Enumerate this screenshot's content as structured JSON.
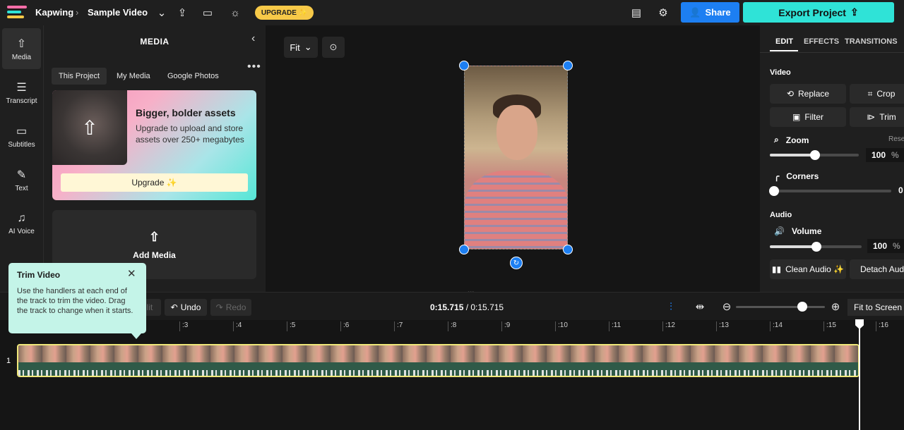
{
  "topbar": {
    "app_name": "Kapwing",
    "project_name": "Sample Video",
    "upgrade_label": "UPGRADE ✨",
    "share_label": "Share",
    "export_label": "Export Project"
  },
  "leftnav": {
    "items": [
      {
        "label": "Media",
        "icon": "upload-icon"
      },
      {
        "label": "Transcript",
        "icon": "transcript-icon"
      },
      {
        "label": "Subtitles",
        "icon": "subtitles-icon"
      },
      {
        "label": "Text",
        "icon": "text-icon"
      },
      {
        "label": "AI Voice",
        "icon": "ai-voice-icon"
      }
    ]
  },
  "media": {
    "title": "MEDIA",
    "tabs": [
      "This Project",
      "My Media",
      "Google Photos"
    ],
    "promo_title": "Bigger, bolder assets",
    "promo_text": "Upgrade to upload and store assets over 250+ megabytes",
    "promo_button": "Upgrade ✨",
    "add_media": "Add Media"
  },
  "canvas": {
    "fit_label": "Fit"
  },
  "right": {
    "tabs": [
      "EDIT",
      "EFFECTS",
      "TRANSITIONS"
    ],
    "video_label": "Video",
    "replace": "Replace",
    "crop": "Crop",
    "filter": "Filter",
    "trim": "Trim",
    "zoom_label": "Zoom",
    "reset": "Reset",
    "zoom_value": "100",
    "corners_label": "Corners",
    "corners_value": "0",
    "audio_label": "Audio",
    "volume_label": "Volume",
    "volume_value": "100",
    "clean_audio": "Clean Audio ✨",
    "detach_audio": "Detach Audio",
    "percent": "%"
  },
  "toolbar": {
    "split_label": "lit",
    "undo_label": "Undo",
    "redo_label": "Redo",
    "current_time": "0:15.715",
    "total_time": " / 0:15.715",
    "fit_screen": "Fit to Screen"
  },
  "timeline": {
    "ticks": [
      ":3",
      ":4",
      ":5",
      ":6",
      ":7",
      ":8",
      ":9",
      ":10",
      ":11",
      ":12",
      ":13",
      ":14",
      ":15",
      ":16"
    ],
    "track_number": "1"
  },
  "tooltip": {
    "title": "Trim Video",
    "body": "Use the handlers at each end of the track to trim the video. Drag the track to change when it starts."
  },
  "colors": {
    "accent_blue": "#1d7ff2",
    "export_teal": "#2fe3d7",
    "upgrade_yellow": "#f7c948",
    "track_border": "#f0e87a"
  }
}
